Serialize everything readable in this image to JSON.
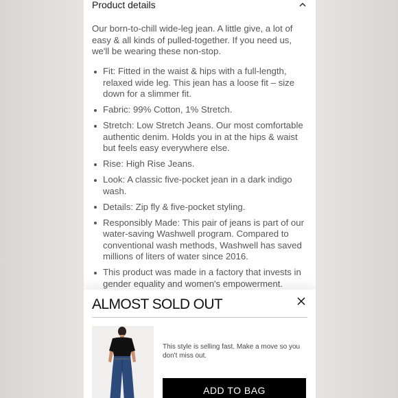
{
  "product_details": {
    "title": "Product details",
    "intro": "Our born-to-chill wide-leg jean. A little give, a lot of easy & all kinds of pulled-together. If you need us, we'll be wearing these non-stop.",
    "bullets": [
      "Fit: Fitted in the waist & hips with a full-length, relaxed wide leg. This jean has a loose fit – size down for a slimmer fit.",
      "Fabric: 99% Cotton, 1% Stretch.",
      "Stretch: Low Stretch Jeans. Our most comfortable authentic denim. Holds you in at the hips & waist but feels easy everywhere else.",
      "Rise: High Rise Jeans.",
      "Look: A classic five-pocket jean in a dark indigo wash.",
      "Details: Zip fly & five-pocket styling.",
      "Responsibly Made: This pair of jeans is part of our water-saving Washwell program. Compared to conventional wash methods, Washwell has saved millions of liters of water since 2016.",
      "This product was made in a factory that invests in gender equality and women's empowerment."
    ]
  },
  "modal": {
    "title": "ALMOST SOLD OUT",
    "message": "This style is selling fast. Make a move so you don't miss out.",
    "add_button_label": "ADD TO BAG"
  },
  "icons": {
    "collapse": "chevron-up-icon",
    "close": "close-icon"
  },
  "colors": {
    "button_bg": "#000000",
    "text": "#555555"
  }
}
